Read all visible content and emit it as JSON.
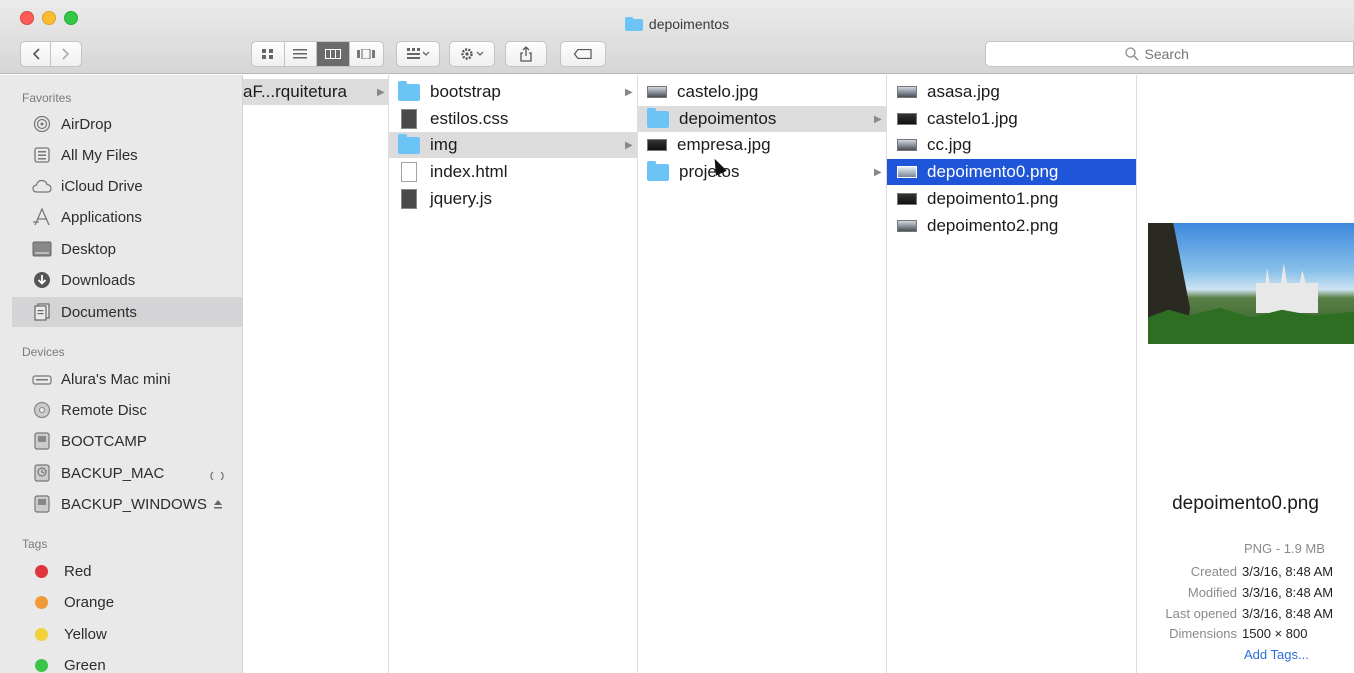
{
  "window": {
    "title": "depoimentos"
  },
  "toolbar": {
    "search_placeholder": "Search"
  },
  "sidebar": {
    "favorites_header": "Favorites",
    "favorites": [
      {
        "label": "AirDrop",
        "icon": "airdrop-icon"
      },
      {
        "label": "All My Files",
        "icon": "all-files-icon"
      },
      {
        "label": "iCloud Drive",
        "icon": "icloud-icon"
      },
      {
        "label": "Applications",
        "icon": "applications-icon"
      },
      {
        "label": "Desktop",
        "icon": "desktop-icon"
      },
      {
        "label": "Downloads",
        "icon": "downloads-icon"
      },
      {
        "label": "Documents",
        "icon": "documents-icon",
        "selected": true
      }
    ],
    "devices_header": "Devices",
    "devices": [
      {
        "label": "Alura's Mac mini",
        "icon": "mac-mini-icon"
      },
      {
        "label": "Remote Disc",
        "icon": "disc-icon"
      },
      {
        "label": "BOOTCAMP",
        "icon": "drive-icon"
      },
      {
        "label": "BACKUP_MAC",
        "icon": "time-machine-icon"
      },
      {
        "label": "BACKUP_WINDOWS",
        "icon": "drive-icon"
      }
    ],
    "tags_header": "Tags",
    "tags": [
      {
        "label": "Red",
        "color": "#e0363b"
      },
      {
        "label": "Orange",
        "color": "#f19a38"
      },
      {
        "label": "Yellow",
        "color": "#f2d13a"
      },
      {
        "label": "Green",
        "color": "#3cc34a"
      }
    ]
  },
  "columns": {
    "col1": [
      {
        "label": "aF...rquitetura"
      }
    ],
    "col2": [
      {
        "label": "bootstrap",
        "type": "folder"
      },
      {
        "label": "estilos.css",
        "type": "file"
      },
      {
        "label": "img",
        "type": "folder"
      },
      {
        "label": "index.html",
        "type": "doc"
      },
      {
        "label": "jquery.js",
        "type": "file"
      }
    ],
    "col3": [
      {
        "label": "castelo.jpg",
        "type": "image"
      },
      {
        "label": "depoimentos",
        "type": "folder"
      },
      {
        "label": "empresa.jpg",
        "type": "image"
      },
      {
        "label": "projetos",
        "type": "folder"
      }
    ],
    "col4": [
      {
        "label": "asasa.jpg",
        "type": "image"
      },
      {
        "label": "castelo1.jpg",
        "type": "image"
      },
      {
        "label": "cc.jpg",
        "type": "image"
      },
      {
        "label": "depoimento0.png",
        "type": "image"
      },
      {
        "label": "depoimento1.png",
        "type": "image"
      },
      {
        "label": "depoimento2.png",
        "type": "image"
      }
    ]
  },
  "preview": {
    "name": "depoimento0.png",
    "type": "PNG - 1.9 MB",
    "created_label": "Created",
    "created": "3/3/16, 8:48 AM",
    "modified_label": "Modified",
    "modified": "3/3/16, 8:48 AM",
    "opened_label": "Last opened",
    "opened": "3/3/16, 8:48 AM",
    "dimensions_label": "Dimensions",
    "dimensions": "1500 × 800",
    "add_tags": "Add Tags..."
  }
}
